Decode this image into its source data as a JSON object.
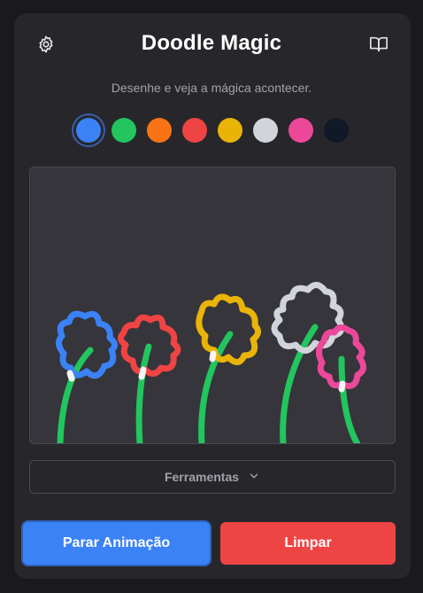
{
  "app": {
    "title": "Doodle Magic",
    "subtitle": "Desenhe e veja a mágica acontecer."
  },
  "header": {
    "left_icon": "gear-icon",
    "right_icon": "book-open-icon"
  },
  "palette": {
    "selected": "blue",
    "colors": [
      {
        "name": "blue",
        "hex": "#3b82f6"
      },
      {
        "name": "green",
        "hex": "#22c55e"
      },
      {
        "name": "orange",
        "hex": "#f97316"
      },
      {
        "name": "red",
        "hex": "#ef4444"
      },
      {
        "name": "yellow",
        "hex": "#eab308"
      },
      {
        "name": "light-gray",
        "hex": "#d1d5db"
      },
      {
        "name": "pink",
        "hex": "#ec4899"
      },
      {
        "name": "navy",
        "hex": "#111827"
      }
    ]
  },
  "canvas": {
    "drawing": "doodle-flowers",
    "stem_color": "#22c55e"
  },
  "tools": {
    "label": "Ferramentas",
    "icon": "chevron-down-icon"
  },
  "actions": {
    "stop_label": "Parar Animação",
    "clear_label": "Limpar"
  },
  "colors": {
    "primary": "#3b82f6",
    "danger": "#ef4444",
    "card": "#27272b",
    "canvas": "#35353b"
  }
}
